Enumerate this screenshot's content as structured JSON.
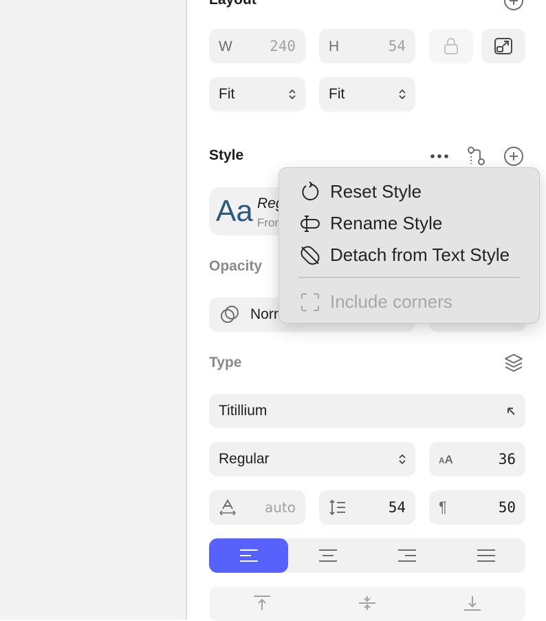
{
  "layout": {
    "title": "Layout",
    "width": {
      "label": "W",
      "value": "240"
    },
    "height": {
      "label": "H",
      "value": "54"
    },
    "width_mode": "Fit",
    "height_mode": "Fit"
  },
  "style": {
    "title": "Style",
    "preview_glyph": "Aa",
    "style_name": "Reg",
    "style_source": "Fron"
  },
  "opacity": {
    "title": "Opacity",
    "blend_mode": "Norr"
  },
  "type": {
    "title": "Type",
    "font_family": "Titillium",
    "font_weight": "Regular",
    "font_size": "36",
    "char_spacing": "auto",
    "line_height": "54",
    "paragraph_spacing": "50"
  },
  "menu": {
    "items": [
      {
        "label": "Reset Style",
        "icon": "reset-icon",
        "enabled": true
      },
      {
        "label": "Rename Style",
        "icon": "rename-icon",
        "enabled": true
      },
      {
        "label": "Detach from Text Style",
        "icon": "detach-icon",
        "enabled": true
      },
      {
        "label": "Include corners",
        "icon": "corners-icon",
        "enabled": false
      }
    ]
  },
  "colors": {
    "accent": "#5662fb",
    "style_glyph": "#2d5a78"
  }
}
